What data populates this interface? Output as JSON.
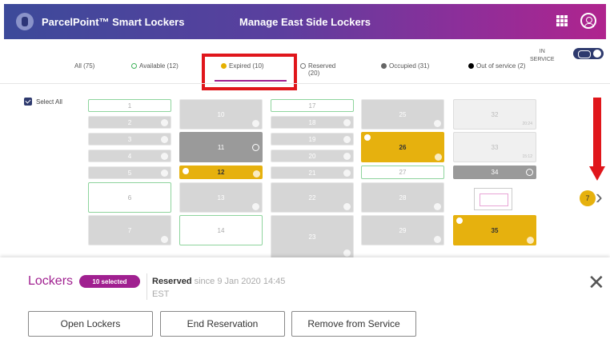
{
  "header": {
    "app_title": "ParcelPoint™ Smart Lockers",
    "page_title": "Manage East Side Lockers"
  },
  "filters": {
    "all": "All (75)",
    "available": "Available (12)",
    "expired": "Expired (10)",
    "reserved": "Reserved\n(20)",
    "occupied": "Occupied (31)",
    "out_of_service": "Out of service (2)"
  },
  "service_toggle": {
    "label": "IN\nSERVICE",
    "on": true
  },
  "select_all_label": "Select All",
  "lockers": [
    {
      "id": "1",
      "state": "available"
    },
    {
      "id": "2",
      "state": "reserved"
    },
    {
      "id": "3",
      "state": "reserved"
    },
    {
      "id": "4",
      "state": "reserved"
    },
    {
      "id": "5",
      "state": "reserved"
    },
    {
      "id": "6",
      "state": "available"
    },
    {
      "id": "7",
      "state": "reserved"
    },
    {
      "id": "10",
      "state": "reserved"
    },
    {
      "id": "11",
      "state": "occupied"
    },
    {
      "id": "12",
      "state": "expired"
    },
    {
      "id": "13",
      "state": "reserved"
    },
    {
      "id": "14",
      "state": "available"
    },
    {
      "id": "17",
      "state": "available"
    },
    {
      "id": "18",
      "state": "reserved"
    },
    {
      "id": "19",
      "state": "reserved"
    },
    {
      "id": "20",
      "state": "reserved"
    },
    {
      "id": "21",
      "state": "reserved"
    },
    {
      "id": "22",
      "state": "reserved"
    },
    {
      "id": "23",
      "state": "reserved"
    },
    {
      "id": "25",
      "state": "reserved"
    },
    {
      "id": "26",
      "state": "expired"
    },
    {
      "id": "27",
      "state": "available"
    },
    {
      "id": "28",
      "state": "reserved"
    },
    {
      "id": "29",
      "state": "reserved"
    },
    {
      "id": "32",
      "state": "oos"
    },
    {
      "id": "33",
      "state": "oos"
    },
    {
      "id": "34",
      "state": "occupied"
    },
    {
      "id": "35",
      "state": "expired"
    }
  ],
  "locker_times": {
    "32": "20:24",
    "33": "15:12"
  },
  "page_badge": "7",
  "selection": {
    "title": "Lockers",
    "selected_count_label": "10 selected",
    "status_label": "Reserved",
    "status_detail": " since 9 Jan 2020 14:45",
    "timezone": "EST"
  },
  "actions": {
    "open": "Open Lockers",
    "end": "End Reservation",
    "remove": "Remove from Service"
  }
}
